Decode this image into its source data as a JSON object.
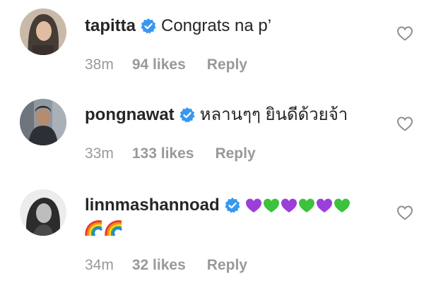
{
  "comments": [
    {
      "username": "tapitta",
      "verified": true,
      "text": "Congrats na p’",
      "time": "38m",
      "likes": "94 likes",
      "reply_label": "Reply",
      "avatar_icon": "avatar-photo"
    },
    {
      "username": "pongnawat",
      "verified": true,
      "text": "หลานๆๆ ยินดีด้วยจ้า",
      "time": "33m",
      "likes": "133 likes",
      "reply_label": "Reply",
      "avatar_icon": "avatar-photo"
    },
    {
      "username": "linnmashannoad",
      "verified": true,
      "emoji_hearts": [
        "purple-heart",
        "green-heart",
        "purple-heart",
        "green-heart",
        "purple-heart",
        "green-heart"
      ],
      "emoji_rainbows": [
        "rainbow",
        "rainbow"
      ],
      "time": "34m",
      "likes": "32 likes",
      "reply_label": "Reply",
      "avatar_icon": "avatar-photo"
    }
  ],
  "colors": {
    "verified_blue": "#3897f0",
    "purple_heart": "#9b3fd8",
    "green_heart": "#3cc23c",
    "meta_gray": "#999999",
    "text": "#262626"
  },
  "icons": {
    "like": "heart-outline-icon",
    "verified": "verified-badge-icon"
  }
}
